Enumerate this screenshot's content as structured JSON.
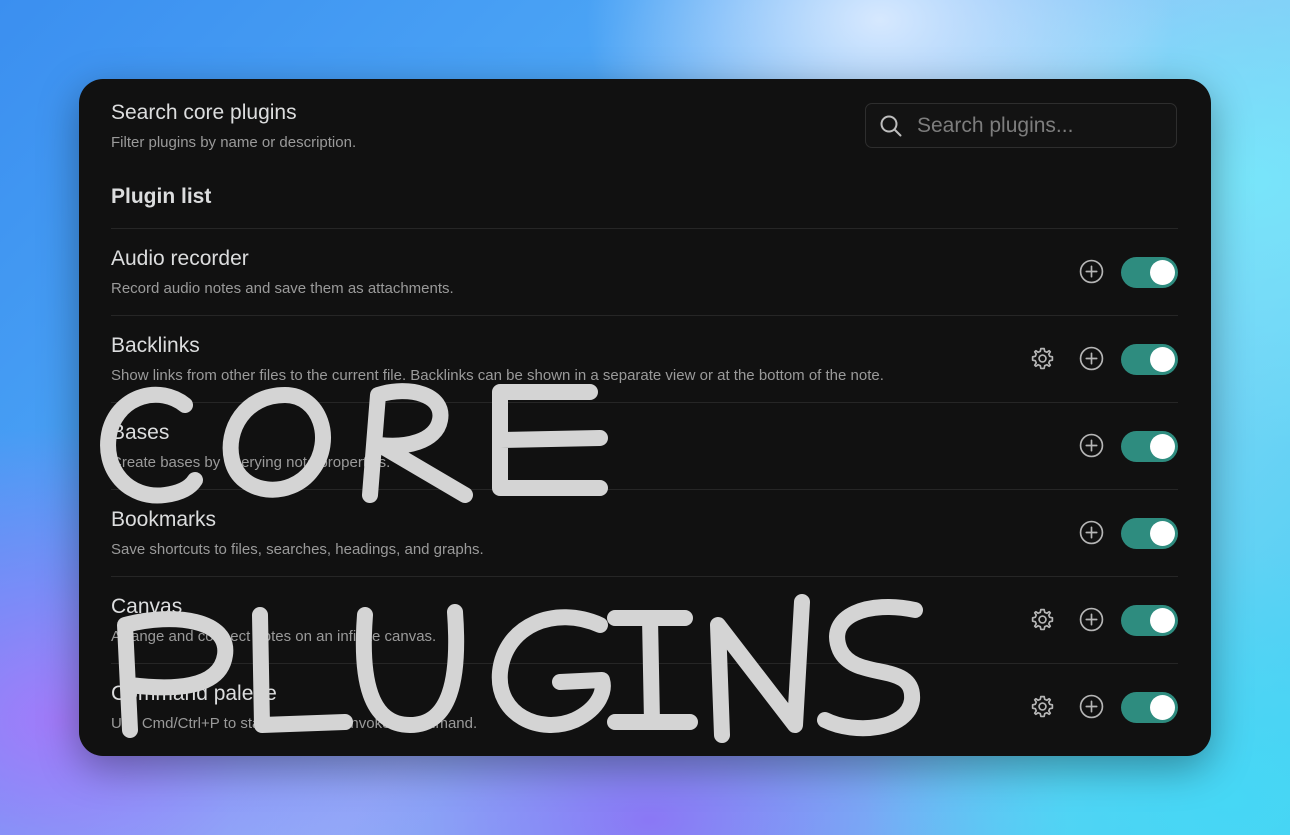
{
  "search": {
    "title": "Search core plugins",
    "description": "Filter plugins by name or description.",
    "placeholder": "Search plugins..."
  },
  "list": {
    "heading": "Plugin list",
    "plugins": [
      {
        "name": "Audio recorder",
        "description": "Record audio notes and save them as attachments.",
        "has_settings": false,
        "enabled": true
      },
      {
        "name": "Backlinks",
        "description": "Show links from other files to the current file. Backlinks can be shown in a separate view or at the bottom of the note.",
        "has_settings": true,
        "enabled": true
      },
      {
        "name": "Bases",
        "description": "Create bases by querying note properties.",
        "has_settings": false,
        "enabled": true
      },
      {
        "name": "Bookmarks",
        "description": "Save shortcuts to files, searches, headings, and graphs.",
        "has_settings": false,
        "enabled": true
      },
      {
        "name": "Canvas",
        "description": "Arrange and connect notes on an infinite canvas.",
        "has_settings": true,
        "enabled": true
      },
      {
        "name": "Command palette",
        "description": "Use Cmd/Ctrl+P to start typing and invoke a command.",
        "has_settings": true,
        "enabled": true
      }
    ]
  },
  "overlay": {
    "line1": "CORE",
    "line2": "PLUGINS"
  },
  "colors": {
    "panel_bg": "#111111",
    "toggle_on": "#2e8c7f",
    "overlay_text": "#d4d4d4"
  }
}
